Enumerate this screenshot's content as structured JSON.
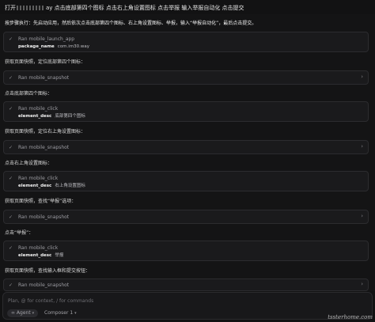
{
  "title": {
    "prefix": "打开",
    "suffix": "ay 点击底部第四个图标 点击右上角设置图标 点击举报 输入举报自动化 点击提交"
  },
  "chat": {
    "line1": "按步骤执行：先启动应用，然后依次点击底部第四个图标、右上角设置图标、举报，输入“举报自动化”，最后点击提交。",
    "line2": "获取页面快照，定位底部第四个图标：",
    "line3": "点击底部第四个图标：",
    "line4": "获取页面快照，定位右上角设置图标：",
    "line5": "点击右上角设置图标：",
    "line6": "获取页面快照，查找“举报”选项：",
    "line7": "点击“举报”：",
    "line8": "获取页面快照，查找输入框和提交按钮："
  },
  "tools": [
    {
      "label": "Ran mobile_launch_app",
      "param_key": "package_name",
      "param_value": "com.im30.way"
    },
    {
      "label": "Ran mobile_snapshot"
    },
    {
      "label": "Ran mobile_click",
      "param_key": "element_desc",
      "param_value": "底部第四个图标"
    },
    {
      "label": "Ran mobile_snapshot"
    },
    {
      "label": "Ran mobile_click",
      "param_key": "element_desc",
      "param_value": "右上角设置图标"
    },
    {
      "label": "Ran mobile_snapshot"
    },
    {
      "label": "Ran mobile_click",
      "param_key": "element_desc",
      "param_value": "举报"
    },
    {
      "label": "Ran mobile_snapshot"
    }
  ],
  "composer": {
    "placeholder": "Plan, @ for context, / for commands",
    "agent_label": "Agent",
    "model_label": "Composer 1"
  },
  "watermark": "tssterhome.com",
  "icons": {
    "check": "check-icon",
    "chevron": "chevron-right-icon",
    "dropdown": "chevron-down-icon"
  }
}
